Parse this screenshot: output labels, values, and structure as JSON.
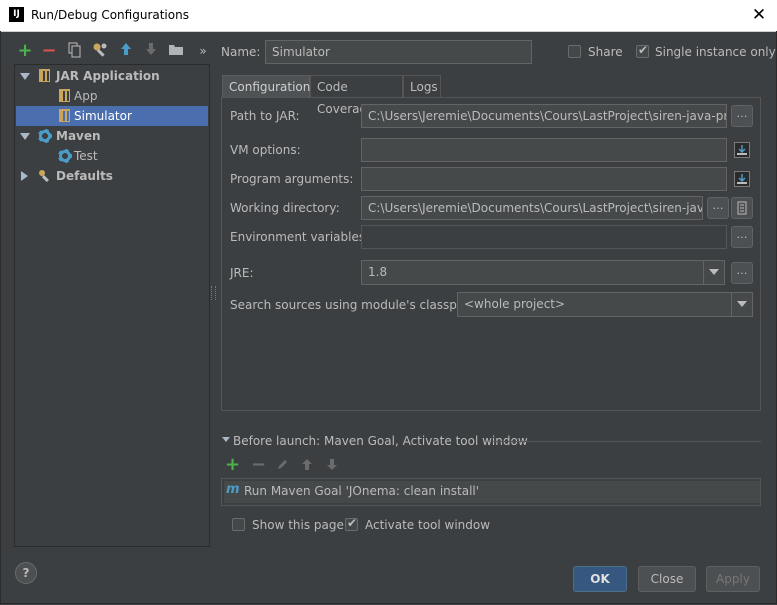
{
  "window": {
    "title": "Run/Debug Configurations",
    "app_icon_text": "IJ"
  },
  "toolbar": {
    "icons": [
      "add-icon",
      "remove-icon",
      "copy-icon",
      "wrench-icon",
      "move-up-icon",
      "move-down-icon",
      "folder-icon",
      "more-icon"
    ]
  },
  "tree": {
    "items": [
      {
        "label": "JAR Application",
        "level": 0,
        "expanded": true
      },
      {
        "label": "App",
        "level": 1
      },
      {
        "label": "Simulator",
        "level": 1,
        "selected": true
      },
      {
        "label": "Maven",
        "level": 0,
        "expanded": true
      },
      {
        "label": "Test",
        "level": 1
      },
      {
        "label": "Defaults",
        "level": 0,
        "expanded": false
      }
    ]
  },
  "name_row": {
    "label": "Name:",
    "value": "Simulator",
    "share_label": "Share",
    "share_checked": false,
    "single_label": "Single instance only",
    "single_checked": true
  },
  "tabs": [
    {
      "label": "Configuration",
      "active": true
    },
    {
      "label": "Code Coverage",
      "active": false
    },
    {
      "label": "Logs",
      "active": false
    }
  ],
  "form": {
    "path_label": "Path to JAR:",
    "path_value": "C:\\Users\\Jeremie\\Documents\\Cours\\LastProject\\siren-java-project\\",
    "vm_label": "VM options:",
    "vm_value": "",
    "args_label": "Program arguments:",
    "args_value": "",
    "wd_label": "Working directory:",
    "wd_value": "C:\\Users\\Jeremie\\Documents\\Cours\\LastProject\\siren-java-pro",
    "env_label": "Environment variables:",
    "env_value": "",
    "jre_label": "JRE:",
    "jre_value": "1.8",
    "classpath_label": "Search sources using module's classpath:",
    "classpath_value": "<whole project>"
  },
  "before_launch": {
    "header": "Before launch: Maven Goal, Activate tool window",
    "task": "Run Maven Goal 'JOnema: clean install'",
    "show_page_label": "Show this page",
    "show_page_checked": false,
    "activate_label": "Activate tool window",
    "activate_checked": true
  },
  "buttons": {
    "ok": "OK",
    "close": "Close",
    "apply": "Apply",
    "help": "?"
  },
  "colors": {
    "accent": "#4b6eaf",
    "add": "#4bb34b",
    "remove": "#d9534f",
    "background": "#3c3f41"
  }
}
